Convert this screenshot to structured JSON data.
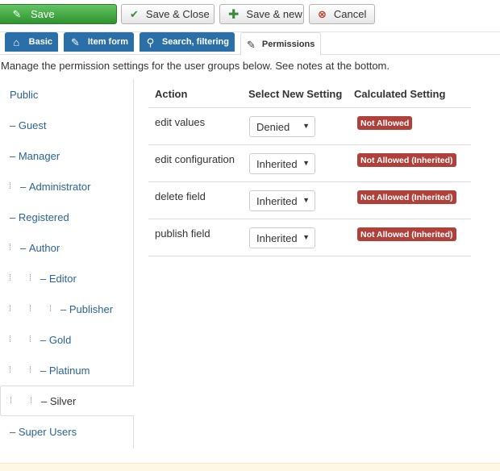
{
  "toolbar": {
    "save": "Save",
    "save_close": "Save & Close",
    "save_new": "Save & new",
    "cancel": "Cancel"
  },
  "tabs": [
    {
      "label": "Basic",
      "icon": "home-icon"
    },
    {
      "label": "Item form",
      "icon": "edit-icon"
    },
    {
      "label": "Search, filtering",
      "icon": "search-icon"
    },
    {
      "label": "Permissions",
      "icon": "plug-icon"
    }
  ],
  "description": "Manage the permission settings for the user groups below. See notes at the bottom.",
  "groups": [
    {
      "label": "Public",
      "prefix": "",
      "depth": 0
    },
    {
      "label": "Guest",
      "prefix": "– ",
      "depth": 0
    },
    {
      "label": "Manager",
      "prefix": "– ",
      "depth": 0
    },
    {
      "label": "Administrator",
      "prefix": "– ",
      "depth": 1
    },
    {
      "label": "Registered",
      "prefix": "– ",
      "depth": 0
    },
    {
      "label": "Author",
      "prefix": "– ",
      "depth": 1
    },
    {
      "label": "Editor",
      "prefix": "– ",
      "depth": 2
    },
    {
      "label": "Publisher",
      "prefix": "– ",
      "depth": 3
    },
    {
      "label": "Gold",
      "prefix": "– ",
      "depth": 2
    },
    {
      "label": "Platinum",
      "prefix": "– ",
      "depth": 2
    },
    {
      "label": "Silver",
      "prefix": "– ",
      "depth": 2,
      "active": true
    },
    {
      "label": "Super Users",
      "prefix": "– ",
      "depth": 0
    }
  ],
  "table": {
    "headers": {
      "action": "Action",
      "select": "Select New Setting",
      "calculated": "Calculated Setting"
    },
    "rows": [
      {
        "action": "edit values",
        "setting": "Denied",
        "calculated": "Not Allowed"
      },
      {
        "action": "edit configuration",
        "setting": "Inherited",
        "calculated": "Not Allowed (Inherited)"
      },
      {
        "action": "delete field",
        "setting": "Inherited",
        "calculated": "Not Allowed (Inherited)"
      },
      {
        "action": "publish field",
        "setting": "Inherited",
        "calculated": "Not Allowed (Inherited)"
      }
    ]
  },
  "colors": {
    "save_green": "#46a546",
    "tab_blue": "#2a6fa8",
    "badge_red": "#b0403a",
    "link_blue": "#2a6496"
  }
}
